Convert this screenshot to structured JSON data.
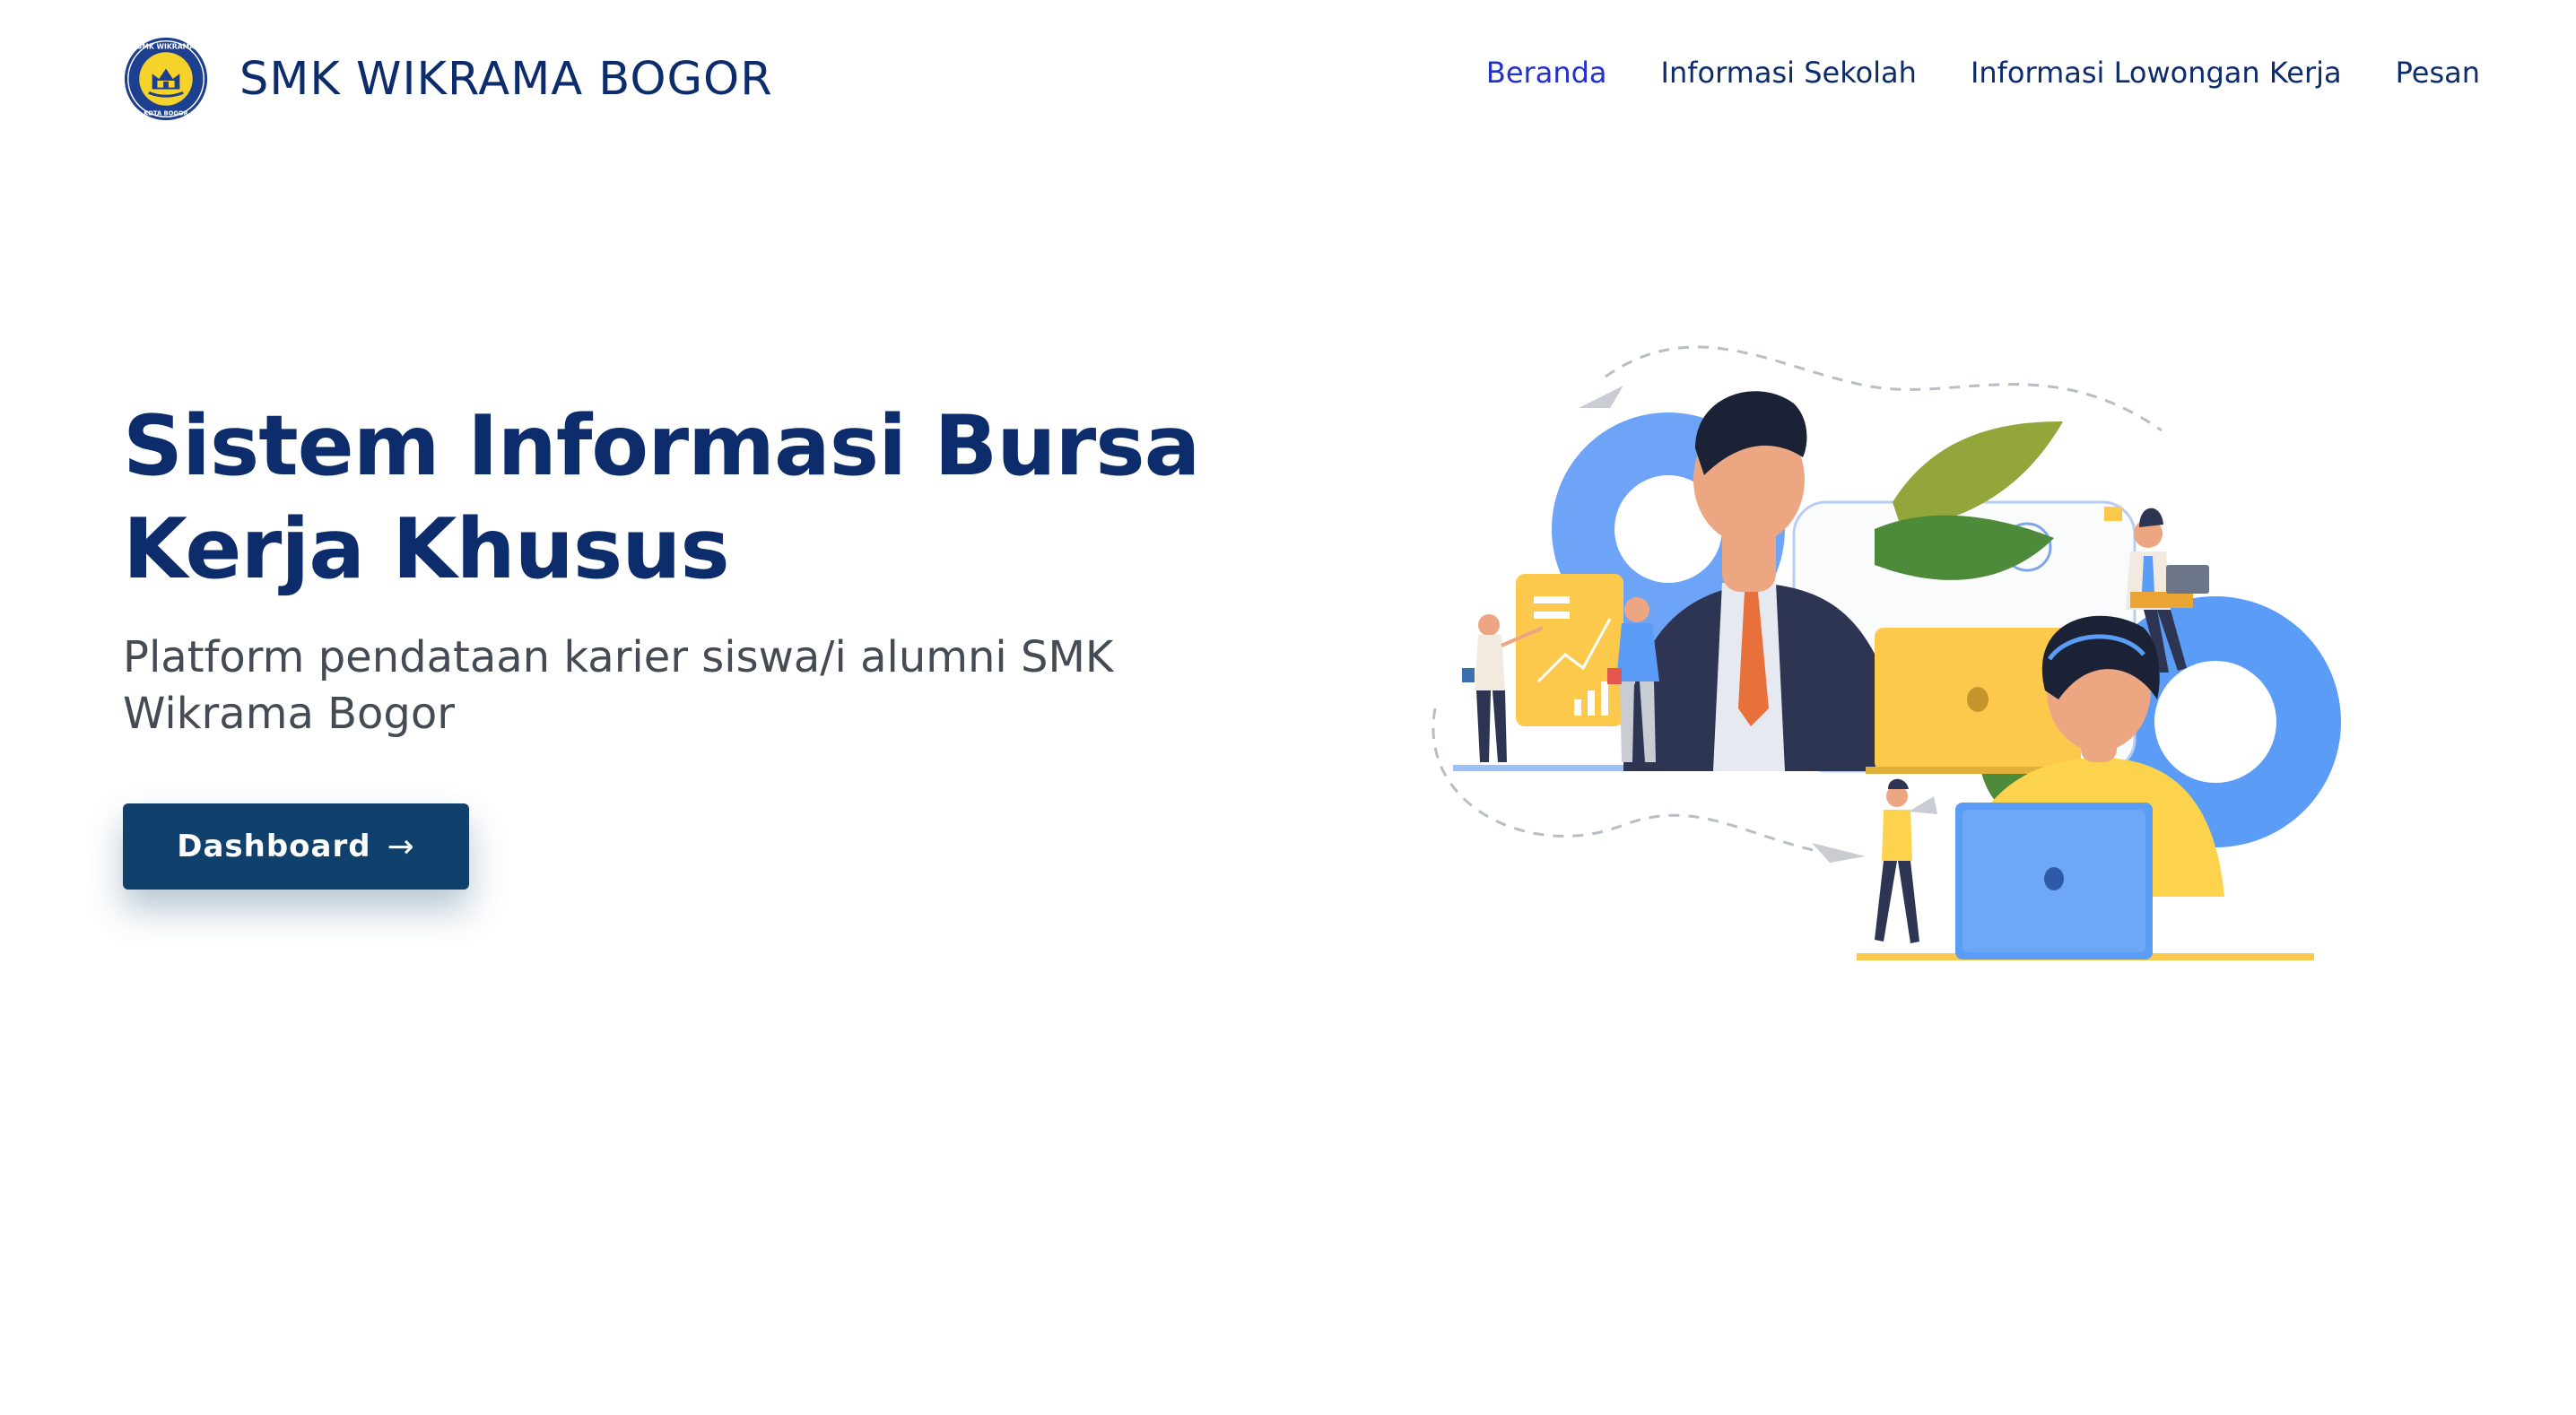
{
  "header": {
    "school_name": "SMK WIKRAMA BOGOR",
    "logo_text_top": "SMK WIKRAMA",
    "logo_text_bottom": "KOTA BOGOR",
    "logo_icon": "school-crest-icon"
  },
  "nav": {
    "items": [
      {
        "label": "Beranda",
        "active": true
      },
      {
        "label": "Informasi Sekolah",
        "active": false
      },
      {
        "label": "Informasi Lowongan Kerja",
        "active": false
      },
      {
        "label": "Pesan",
        "active": false
      }
    ]
  },
  "hero": {
    "title": "Sistem Informasi Bursa Kerja Khusus",
    "subtitle": "Platform pendataan karier siswa/i alumni SMK Wikrama Bogor",
    "button_label": "Dashboard",
    "button_icon": "arrow-right-icon",
    "illustration_icon": "team-work-illustration-icon"
  },
  "colors": {
    "primary": "#0c2c6c",
    "active_link": "#2330c9",
    "button": "#10416d",
    "accent_yellow": "#fdc94c",
    "accent_blue": "#5b9cf6"
  }
}
